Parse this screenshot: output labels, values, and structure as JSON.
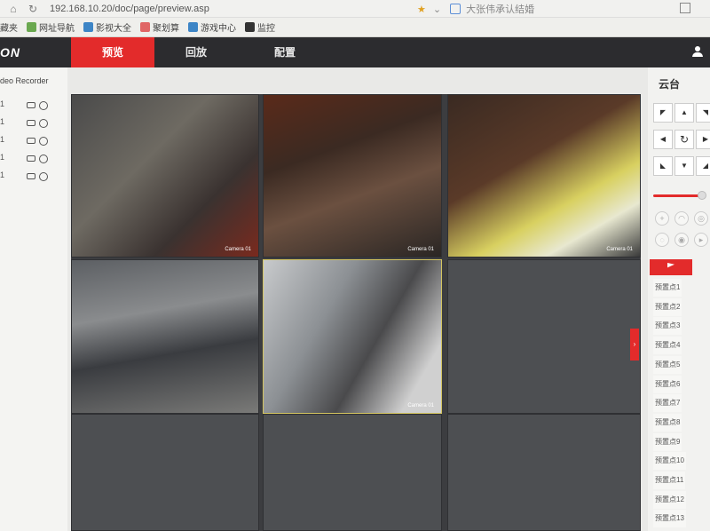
{
  "browser": {
    "url": "192.168.10.20/doc/page/preview.asp",
    "tab_title": "大张伟承认结婚",
    "bookmarks": [
      {
        "label": "藏夹",
        "color": "#c9a84a"
      },
      {
        "label": "网址导航",
        "color": "#6aa84f"
      },
      {
        "label": "影视大全",
        "color": "#3d85c6"
      },
      {
        "label": "聚划算",
        "color": "#e06666"
      },
      {
        "label": "游戏中心",
        "color": "#3d85c6"
      },
      {
        "label": "监控",
        "color": "#333333"
      }
    ]
  },
  "nvr": {
    "brand": "ON",
    "menu": [
      {
        "label": "预览",
        "active": true
      },
      {
        "label": "回放",
        "active": false
      },
      {
        "label": "配置",
        "active": false
      }
    ],
    "channel_panel_title": "deo Recorder",
    "channels": [
      "1",
      "1",
      "1",
      "1",
      "1"
    ]
  },
  "video_cells": [
    {
      "label": "Camera 01",
      "scene": "alley",
      "active": false
    },
    {
      "label": "Camera 01",
      "scene": "dining",
      "active": false
    },
    {
      "label": "Camera 01",
      "scene": "bar",
      "active": false
    },
    {
      "label": "",
      "scene": "kitchen",
      "active": false
    },
    {
      "label": "Camera 01",
      "scene": "prep",
      "active": true
    },
    {
      "label": "",
      "scene": "empty",
      "active": false
    },
    {
      "label": "",
      "scene": "empty",
      "active": false
    },
    {
      "label": "",
      "scene": "empty",
      "active": false
    },
    {
      "label": "",
      "scene": "empty",
      "active": false
    }
  ],
  "ptz": {
    "title": "云台",
    "presets": [
      "预置点1",
      "预置点2",
      "预置点3",
      "预置点4",
      "预置点5",
      "预置点6",
      "预置点7",
      "预置点8",
      "预置点9",
      "预置点10",
      "预置点11",
      "预置点12",
      "预置点13"
    ]
  },
  "colors": {
    "accent_red": "#e32b2b",
    "header_dark": "#2c2c2f",
    "active_cell_border": "#d4c560"
  }
}
